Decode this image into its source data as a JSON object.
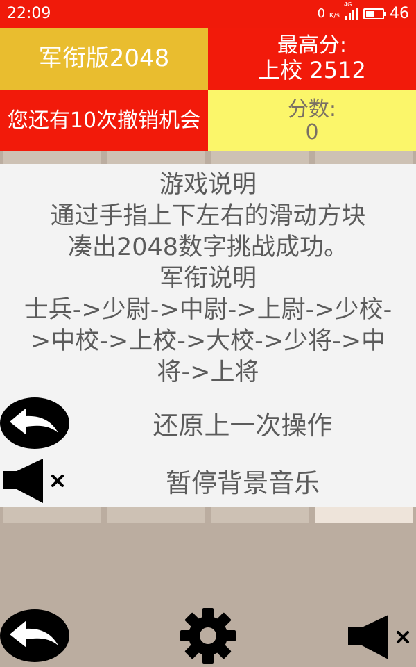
{
  "status": {
    "time": "22:09",
    "net_speed": "0",
    "net_unit": "K/s",
    "network": "4G",
    "battery": "46"
  },
  "header": {
    "title": "军衔版2048",
    "best_label": "最高分:",
    "best_value": "上校 2512",
    "undo_info": "您还有10次撤销机会",
    "score_label": "分数:",
    "score_value": "0"
  },
  "help": {
    "title": "游戏说明",
    "line1": "通过手指上下左右的滑动方块",
    "line2": "凑出2048数字挑战成功。",
    "rank_title": "军衔说明",
    "ranks_part1": "士兵->少尉->中尉->上尉->少校-",
    "ranks_part2": ">中校->上校->大校->少将->中",
    "ranks_part3": "将->上将",
    "undo_action": "还原上一次操作",
    "mute_action": "暂停背景音乐"
  },
  "icons": {
    "undo": "undo-arrow-icon",
    "mute": "speaker-mute-icon",
    "settings": "gear-icon"
  },
  "colors": {
    "red": "#f21a0a",
    "gold": "#e9bd2f",
    "yellow": "#fbf66a",
    "board": "#bbada0",
    "tile_empty": "#cdc1b4"
  }
}
